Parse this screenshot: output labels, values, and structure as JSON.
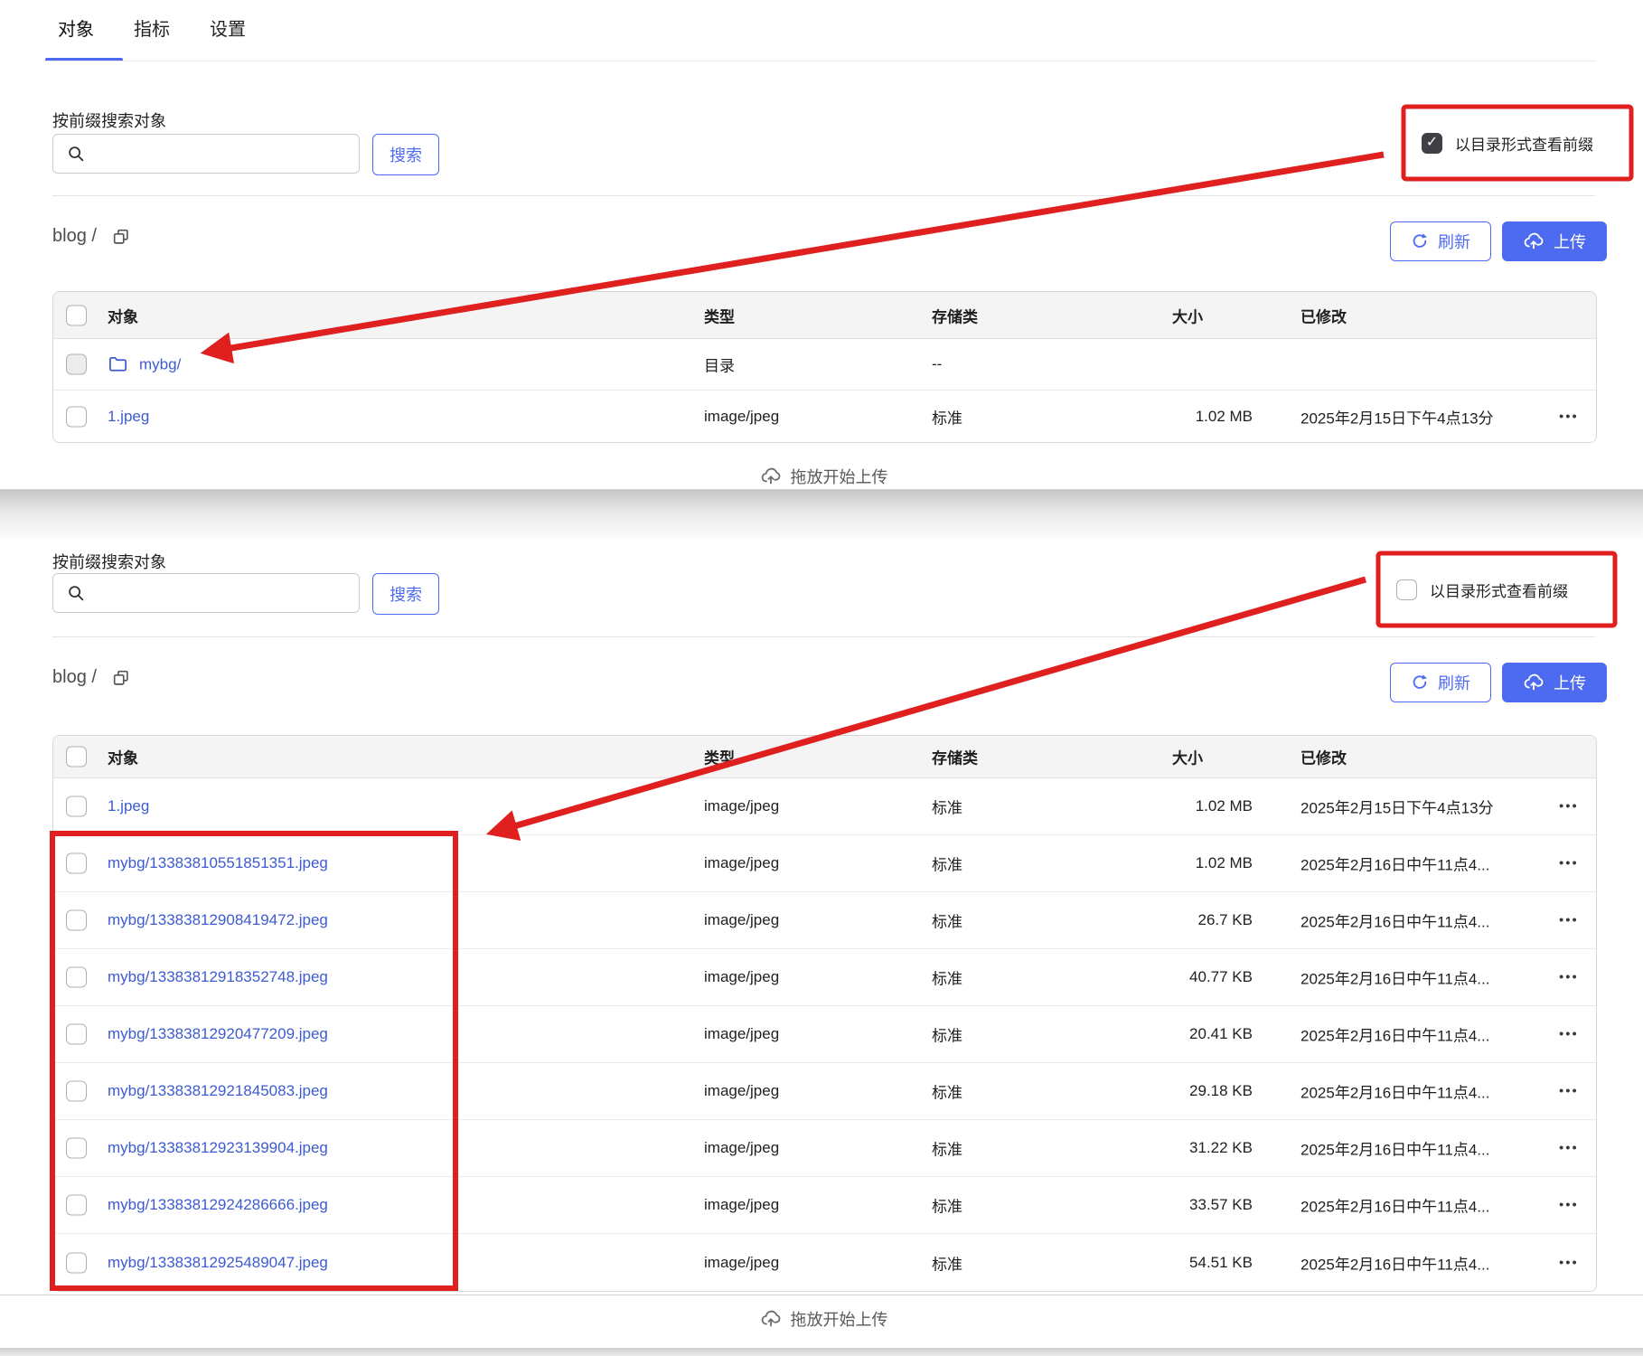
{
  "colors": {
    "accent_blue": "#4d6bf0",
    "link_blue": "#3d5bd0",
    "annotation_red": "#e01f1f"
  },
  "tabs": [
    {
      "label": "对象",
      "active": true
    },
    {
      "label": "指标",
      "active": false
    },
    {
      "label": "设置",
      "active": false
    }
  ],
  "shared": {
    "search_label": "按前缀搜索对象",
    "search_placeholder": "",
    "search_button": "搜索",
    "view_prefix_checkbox_label": "以目录形式查看前缀",
    "breadcrumb": "blog /",
    "refresh_button": "刷新",
    "upload_button": "上传",
    "drop_hint": "拖放开始上传",
    "menu_dots": "•••",
    "check_glyph": "✓",
    "columns": {
      "object": "对象",
      "type": "类型",
      "storage_class": "存储类",
      "size": "大小",
      "modified": "已修改"
    }
  },
  "icons": {
    "search": "magnifier-icon",
    "copy": "copy-icon",
    "refresh": "refresh-icon",
    "upload": "cloud-upload-icon",
    "folder": "folder-icon",
    "row_menu": "three-dots-icon"
  },
  "panel_directory_view": {
    "checkbox_checked": true,
    "rows": [
      {
        "name": "mybg/",
        "is_folder": true,
        "type": "目录",
        "storage_class": "--",
        "size": "",
        "modified": "",
        "has_menu": false
      },
      {
        "name": "1.jpeg",
        "is_folder": false,
        "type": "image/jpeg",
        "storage_class": "标准",
        "size": "1.02 MB",
        "modified": "2025年2月15日下午4点13分",
        "has_menu": true
      }
    ]
  },
  "panel_flat_view": {
    "checkbox_checked": false,
    "rows": [
      {
        "name": "1.jpeg",
        "is_folder": false,
        "type": "image/jpeg",
        "storage_class": "标准",
        "size": "1.02 MB",
        "modified": "2025年2月15日下午4点13分",
        "has_menu": true
      },
      {
        "name": "mybg/13383810551851351.jpeg",
        "is_folder": false,
        "type": "image/jpeg",
        "storage_class": "标准",
        "size": "1.02 MB",
        "modified": "2025年2月16日中午11点4...",
        "has_menu": true
      },
      {
        "name": "mybg/13383812908419472.jpeg",
        "is_folder": false,
        "type": "image/jpeg",
        "storage_class": "标准",
        "size": "26.7 KB",
        "modified": "2025年2月16日中午11点4...",
        "has_menu": true
      },
      {
        "name": "mybg/13383812918352748.jpeg",
        "is_folder": false,
        "type": "image/jpeg",
        "storage_class": "标准",
        "size": "40.77 KB",
        "modified": "2025年2月16日中午11点4...",
        "has_menu": true
      },
      {
        "name": "mybg/13383812920477209.jpeg",
        "is_folder": false,
        "type": "image/jpeg",
        "storage_class": "标准",
        "size": "20.41 KB",
        "modified": "2025年2月16日中午11点4...",
        "has_menu": true
      },
      {
        "name": "mybg/13383812921845083.jpeg",
        "is_folder": false,
        "type": "image/jpeg",
        "storage_class": "标准",
        "size": "29.18 KB",
        "modified": "2025年2月16日中午11点4...",
        "has_menu": true
      },
      {
        "name": "mybg/13383812923139904.jpeg",
        "is_folder": false,
        "type": "image/jpeg",
        "storage_class": "标准",
        "size": "31.22 KB",
        "modified": "2025年2月16日中午11点4...",
        "has_menu": true
      },
      {
        "name": "mybg/13383812924286666.jpeg",
        "is_folder": false,
        "type": "image/jpeg",
        "storage_class": "标准",
        "size": "33.57 KB",
        "modified": "2025年2月16日中午11点4...",
        "has_menu": true
      },
      {
        "name": "mybg/13383812925489047.jpeg",
        "is_folder": false,
        "type": "image/jpeg",
        "storage_class": "标准",
        "size": "54.51 KB",
        "modified": "2025年2月16日中午11点4...",
        "has_menu": true
      }
    ]
  }
}
